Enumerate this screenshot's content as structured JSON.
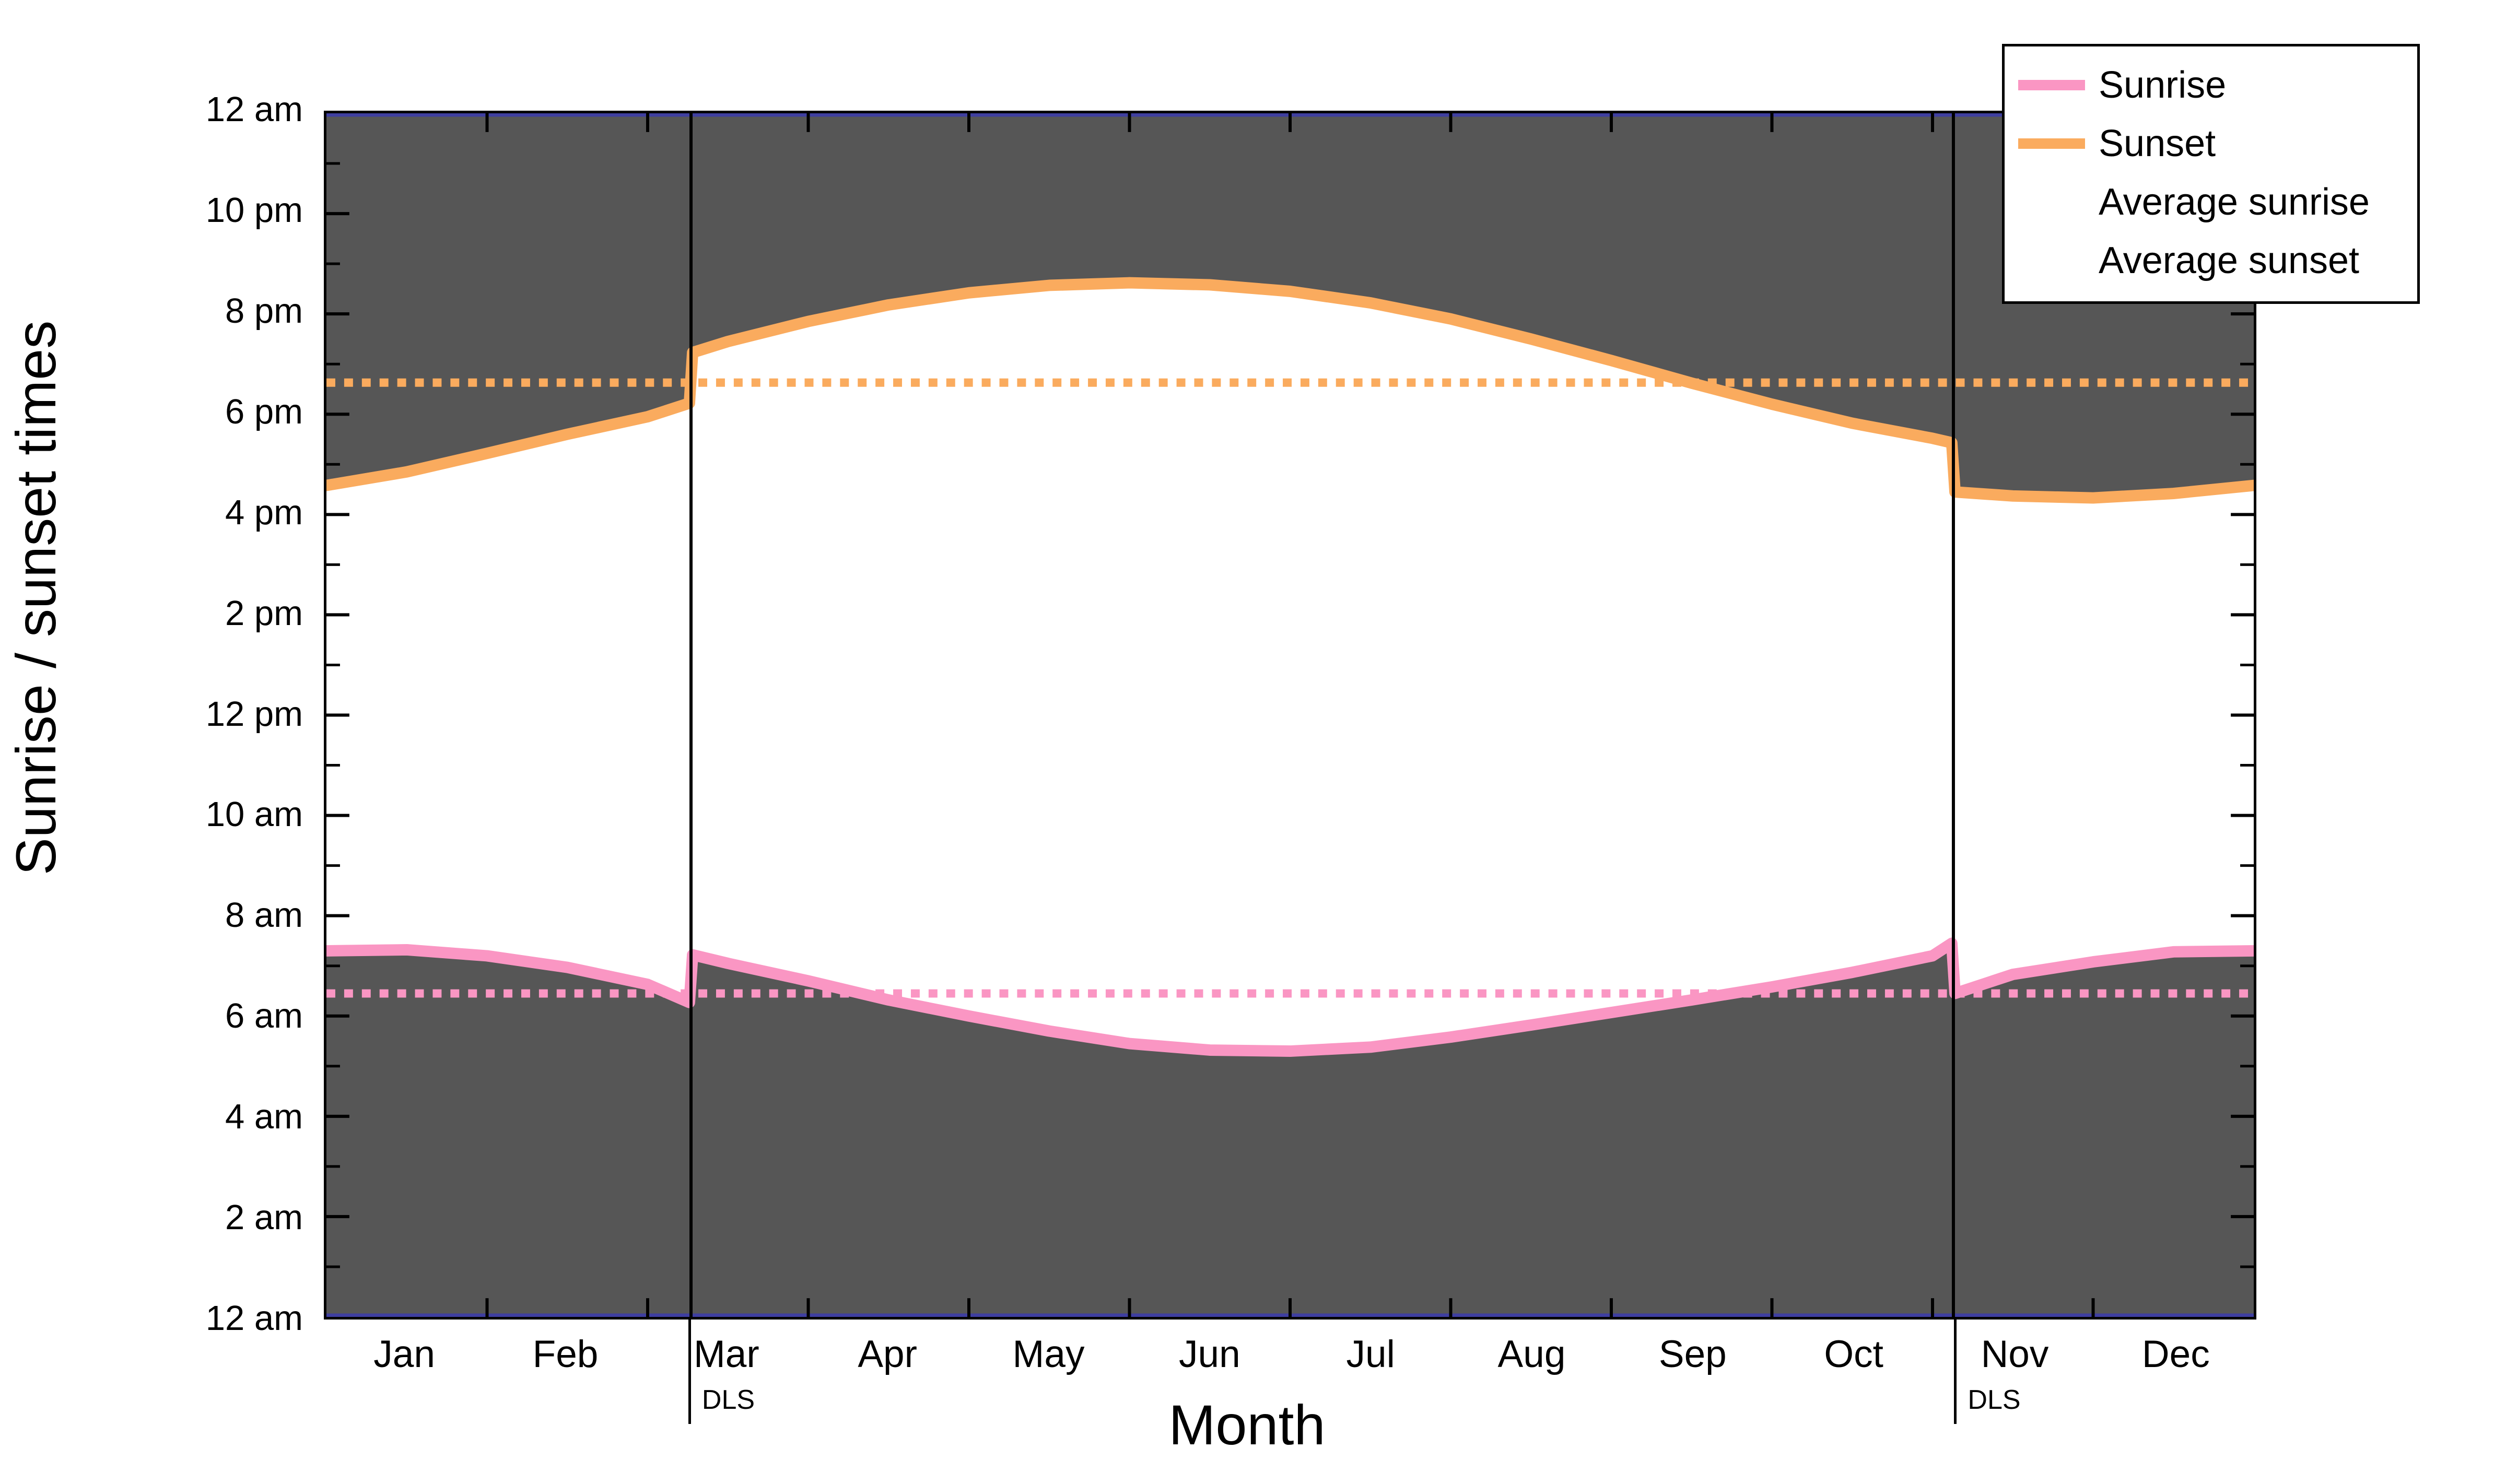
{
  "chart_data": {
    "type": "line",
    "title": "",
    "xlabel": "Month",
    "ylabel": "Sunrise / sunset times",
    "grid": false,
    "legend_position": "top-right",
    "x_tick_labels": [
      "Jan",
      "Feb",
      "Mar",
      "Apr",
      "May",
      "Jun",
      "Jul",
      "Aug",
      "Sep",
      "Oct",
      "Nov",
      "Dec"
    ],
    "y_tick_labels": [
      "12 am",
      "10 pm",
      "8 pm",
      "6 pm",
      "4 pm",
      "2 pm",
      "12 pm",
      "10 am",
      "8 am",
      "6 am",
      "4 am",
      "2 am",
      "12 am"
    ],
    "y_tick_hours": [
      24,
      22,
      20,
      18,
      16,
      14,
      12,
      10,
      8,
      6,
      4,
      2,
      0
    ],
    "ylim_hours": [
      0,
      24
    ],
    "y_axis_direction": "inverted",
    "annotations": [
      {
        "label": "DLS",
        "x_month": 3.27,
        "note": "spring daylight-saving transition"
      },
      {
        "label": "DLS",
        "x_month": 11.13,
        "note": "autumn daylight-saving transition"
      }
    ],
    "series": [
      {
        "name": "Sunrise",
        "color": "#fa96c3",
        "style": "solid",
        "unit": "hours after midnight",
        "x_months": [
          1.0,
          1.5,
          2.0,
          2.5,
          3.0,
          3.26,
          3.28,
          3.5,
          4.0,
          4.5,
          5.0,
          5.5,
          6.0,
          6.5,
          7.0,
          7.5,
          8.0,
          8.5,
          9.0,
          9.5,
          10.0,
          10.5,
          11.0,
          11.12,
          11.14,
          11.5,
          12.0,
          12.5,
          13.0
        ],
        "values": [
          7.3,
          7.32,
          7.2,
          6.97,
          6.63,
          6.27,
          7.22,
          7.05,
          6.7,
          6.32,
          6.0,
          5.7,
          5.45,
          5.32,
          5.3,
          5.38,
          5.58,
          5.82,
          6.07,
          6.32,
          6.58,
          6.87,
          7.2,
          7.45,
          6.45,
          6.83,
          7.08,
          7.28,
          7.3
        ]
      },
      {
        "name": "Sunset",
        "color": "#faab5e",
        "style": "solid",
        "unit": "hours after midnight",
        "x_months": [
          1.0,
          1.5,
          2.0,
          2.5,
          3.0,
          3.26,
          3.28,
          3.5,
          4.0,
          4.5,
          5.0,
          5.5,
          6.0,
          6.5,
          7.0,
          7.5,
          8.0,
          8.5,
          9.0,
          9.5,
          10.0,
          10.5,
          11.0,
          11.12,
          11.14,
          11.5,
          12.0,
          12.5,
          13.0
        ],
        "values": [
          16.58,
          16.85,
          17.22,
          17.6,
          17.95,
          18.22,
          19.23,
          19.45,
          19.85,
          20.18,
          20.42,
          20.57,
          20.62,
          20.58,
          20.45,
          20.22,
          19.9,
          19.5,
          19.07,
          18.62,
          18.2,
          17.82,
          17.52,
          17.43,
          16.45,
          16.37,
          16.33,
          16.42,
          16.58
        ]
      },
      {
        "name": "Average sunrise",
        "color": "#fa96c3",
        "style": "dotted",
        "unit": "hours after midnight",
        "constant_value": 6.45
      },
      {
        "name": "Average sunset",
        "color": "#faab5e",
        "style": "dotted",
        "unit": "hours after midnight",
        "constant_value": 18.63
      }
    ],
    "shading": {
      "night_fill": "#565656",
      "day_fill": "#ffffff",
      "description": "Region between sunset and sunrise (night) filled dark grey; daytime left white."
    }
  },
  "axes": {
    "y_label": "Sunrise / sunset times",
    "x_label": "Month",
    "y_ticks": [
      "12 am",
      "10 pm",
      "8 pm",
      "6 pm",
      "4 pm",
      "2 pm",
      "12 pm",
      "10 am",
      "8 am",
      "6 am",
      "4 am",
      "2 am",
      "12 am"
    ],
    "x_ticks": [
      "Jan",
      "Feb",
      "Mar",
      "Apr",
      "May",
      "Jun",
      "Jul",
      "Aug",
      "Sep",
      "Oct",
      "Nov",
      "Dec"
    ]
  },
  "legend": {
    "items": [
      {
        "label": "Sunrise",
        "color": "#fa96c3",
        "style": "solid"
      },
      {
        "label": "Sunset",
        "color": "#faab5e",
        "style": "solid"
      },
      {
        "label": "Average sunrise",
        "color": "#fa96c3",
        "style": "dotted"
      },
      {
        "label": "Average sunset",
        "color": "#faab5e",
        "style": "dotted"
      }
    ]
  },
  "annotations": {
    "dls_left": "DLS",
    "dls_right": "DLS"
  },
  "colors": {
    "sunrise": "#fa96c3",
    "sunset": "#faab5e",
    "night": "#565656",
    "axis": "#000000",
    "top_edge": "#3f3fa0"
  }
}
